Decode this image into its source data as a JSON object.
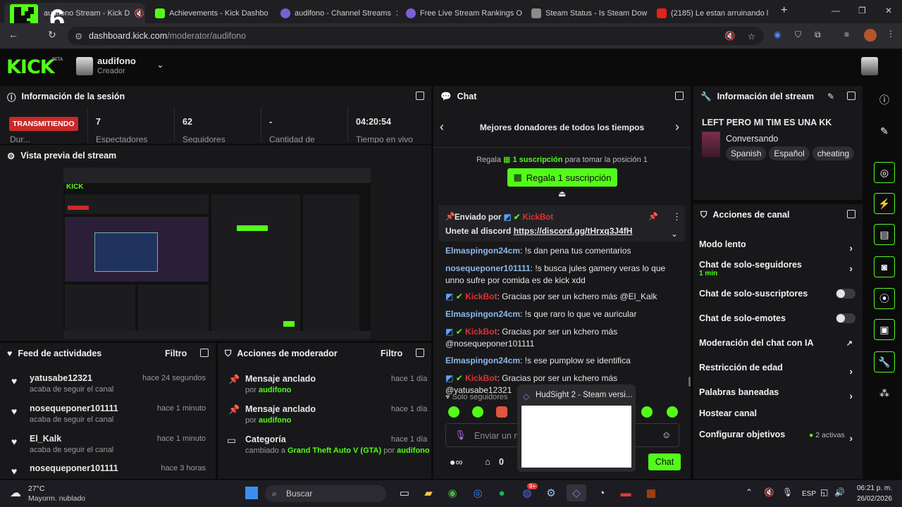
{
  "browser": {
    "tabs": [
      {
        "label": "audifono Stream - Kick D"
      },
      {
        "label": "Achievements - Kick Dashbo"
      },
      {
        "label": "audifono - Channel Streams"
      },
      {
        "label": "Free Live Stream Rankings O"
      },
      {
        "label": "Steam Status - Is Steam Dow"
      },
      {
        "label": "(2185) Le estan arruinando l"
      }
    ],
    "new_tab": "+",
    "url_host": "dashboard.kick.com",
    "url_path": "/moderator/audifono",
    "overlay_num": "6"
  },
  "header": {
    "logo": "KICK",
    "beta": "BETA",
    "channel": "audifono",
    "role": "Creador"
  },
  "session": {
    "title": "Información de la sesión",
    "live_badge": "TRANSMITIENDO",
    "live_sub": "Dur...",
    "stats": [
      {
        "value": "7",
        "label": "Espectadores"
      },
      {
        "value": "62",
        "label": "Seguidores"
      },
      {
        "value": "-",
        "label": "Cantidad de"
      },
      {
        "value": "04:20:54",
        "label": "Tiempo en vivo"
      }
    ]
  },
  "preview": {
    "title": "Vista previa del stream"
  },
  "feed": {
    "title": "Feed de actividades",
    "filter": "Filtro",
    "items": [
      {
        "name": "yatusabe12321",
        "sub": "acaba de seguir el canal",
        "time": "hace 24 segundos"
      },
      {
        "name": "nosequeponer101111",
        "sub": "acaba de seguir el canal",
        "time": "hace 1 minuto"
      },
      {
        "name": "El_Kalk",
        "sub": "acaba de seguir el canal",
        "time": "hace 1 minuto"
      },
      {
        "name": "nosequeponer101111",
        "sub": "",
        "time": "hace 3 horas"
      }
    ]
  },
  "modactions": {
    "title": "Acciones de moderador",
    "filter": "Filtro",
    "items": [
      {
        "name": "Mensaje anclado",
        "by": "por",
        "user": "audifono",
        "time": "hace 1 día"
      },
      {
        "name": "Mensaje anclado",
        "by": "por",
        "user": "audifono",
        "time": "hace 1 día"
      },
      {
        "name": "Categoría",
        "by": "cambiado a",
        "game": "Grand Theft Auto V (GTA)",
        "by2": "por",
        "user": "audifono",
        "time": "hace 1 día"
      }
    ]
  },
  "chat": {
    "title": "Chat",
    "donors_title": "Mejores donadores de todos los tiempos",
    "gift_pre": "Regala",
    "gift_amount": "1 suscripción",
    "gift_post": "para tomar la posición 1",
    "gift_button": "Regala 1 suscripción",
    "pinned_by": "Enviado por",
    "pinned_user": "KickBot",
    "pinned_text": "Unete al discord ",
    "pinned_link": "https://discord.gg/tHrxq3J4fH",
    "messages": [
      {
        "user": "Elmaspingon24cm",
        "text": ": !s dan pena tus comentarios"
      },
      {
        "user": "nosequeponer101111",
        "text": ": !s busca jules gamery veras lo que unno sufre por comida es de kick xdd"
      },
      {
        "user": "KickBot",
        "text": ": Gracias por ser un kchero más @El_Kalk"
      },
      {
        "user": "Elmaspingon24cm",
        "text": ": !s que raro lo que ve auricular"
      },
      {
        "user": "KickBot",
        "text": ": Gracias por ser un kchero más @nosequeponer101111"
      },
      {
        "user": "Elmaspingon24cm",
        "text": ": !s ese pumplow se identifica"
      },
      {
        "user": "KickBot",
        "text": ": Gracias por ser un kchero más @yatusabe12321"
      }
    ],
    "followers_only": "Solo seguidores",
    "input_placeholder": "Enviar un m",
    "count": "0",
    "send": "Chat"
  },
  "stream_info": {
    "title": "Información del stream",
    "stream_title": "LEFT PERO MI TIM ES UNA KK",
    "category": "Conversando",
    "tags": [
      "Spanish",
      "Español",
      "cheating"
    ]
  },
  "channel_actions": {
    "title": "Acciones de canal",
    "items": [
      {
        "label": "Modo lento",
        "control": "chevron"
      },
      {
        "label": "Chat de solo-seguidores",
        "sub": "1 min",
        "control": "chevron"
      },
      {
        "label": "Chat de solo-suscriptores",
        "control": "toggle"
      },
      {
        "label": "Chat de solo-emotes",
        "control": "toggle"
      },
      {
        "label": "Moderación del chat con IA",
        "control": "external"
      },
      {
        "label": "Restricción de edad",
        "control": "chevron"
      },
      {
        "label": "Palabras baneadas",
        "control": "chevron"
      },
      {
        "label": "Hostear canal",
        "control": "none"
      },
      {
        "label": "Configurar objetivos",
        "sub": "2 activas",
        "control": "chevron"
      }
    ]
  },
  "popup": {
    "title": "HudSight 2 - Steam versi..."
  },
  "taskbar": {
    "temp": "27°C",
    "weather": "Mayorm. nublado",
    "search": "Buscar",
    "lang": "ESP",
    "time": "06:21 p. m.",
    "date": "26/02/2026",
    "discord_badge": "9+"
  },
  "colors": {
    "kick_green": "#53fc18",
    "live_red": "#c92a2a",
    "bot_red": "#e03131",
    "user_blue": "#8fb8e8"
  }
}
